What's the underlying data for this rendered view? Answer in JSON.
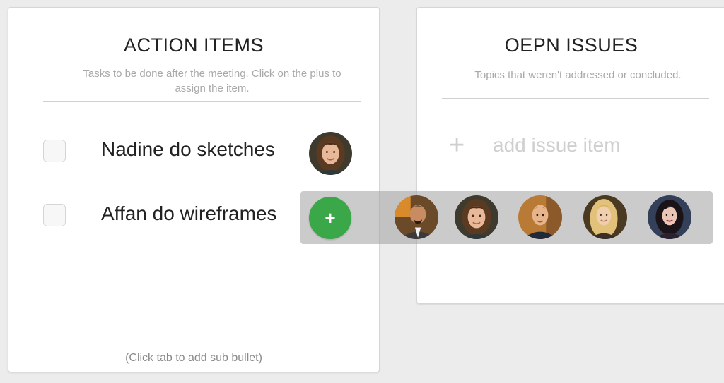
{
  "action_items": {
    "title": "ACTION ITEMS",
    "subtitle": "Tasks to be done after the meeting.  Click on the plus to assign the item.",
    "tasks": [
      {
        "label": "Nadine do sketches",
        "checked": false,
        "assignee_icon": "avatar-woman-brunette"
      },
      {
        "label": "Affan do wireframes",
        "checked": false,
        "assignee_icon": ""
      }
    ],
    "footer_hint": "(Click tab to add sub bullet)"
  },
  "open_issues": {
    "title": "OEPN ISSUES",
    "subtitle": "Topics that weren't addressed or concluded.",
    "add_placeholder": "add issue item",
    "add_icon": "plus-icon"
  },
  "assign_bar": {
    "add_icon": "+",
    "people": [
      {
        "icon": "avatar-man-suit"
      },
      {
        "icon": "avatar-woman-brunette"
      },
      {
        "icon": "avatar-man-short-hair"
      },
      {
        "icon": "avatar-woman-blonde"
      },
      {
        "icon": "avatar-woman-dark-hair"
      }
    ]
  },
  "colors": {
    "accent_green": "#3aa848",
    "muted_text": "#a9a9a9",
    "background": "#ececec"
  }
}
